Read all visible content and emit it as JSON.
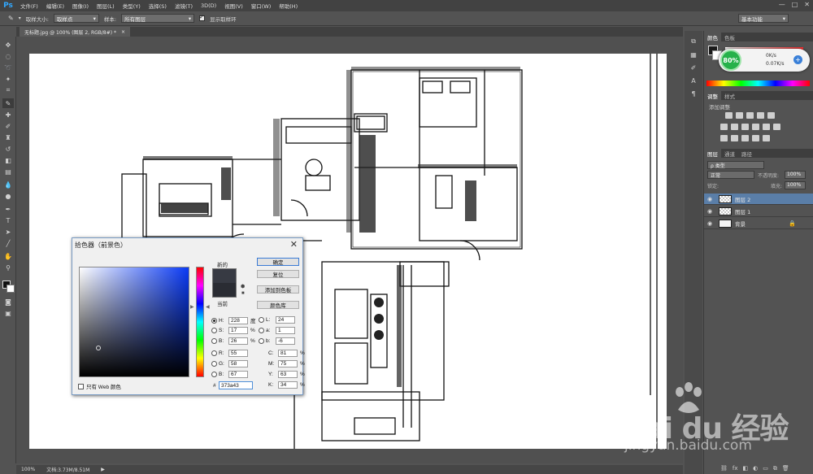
{
  "app": {
    "logo": "Ps"
  },
  "menu": [
    "文件(F)",
    "编辑(E)",
    "图像(I)",
    "图层(L)",
    "类型(Y)",
    "选择(S)",
    "滤镜(T)",
    "3D(D)",
    "视图(V)",
    "窗口(W)",
    "帮助(H)"
  ],
  "window_controls": {
    "minimize": "—",
    "maximize": "□",
    "close": "✕"
  },
  "options": {
    "sample_size_label": "取样大小:",
    "sample_size_value": "取样点",
    "sample_label": "样本:",
    "sample_value": "所有图层",
    "show_ring_label": "显示取样环",
    "workspace": "基本功能"
  },
  "document_tab": {
    "title": "无标题.jpg @ 100% (图层 2, RGB/8#) *",
    "close": "×"
  },
  "status": {
    "zoom": "100%",
    "doc": "文档:3.73M/8.51M"
  },
  "panels": {
    "color_tabs": [
      "颜色",
      "色板"
    ],
    "adjust_tabs": [
      "调整",
      "样式"
    ],
    "adjust_add_label": "添加调整",
    "layer_tabs": [
      "图层",
      "通道",
      "路径"
    ],
    "layer_filter": "ρ 类型",
    "blend_mode": "正常",
    "opacity_label": "不透明度:",
    "opacity_value": "100%",
    "lock_label": "锁定:",
    "fill_label": "填充:",
    "fill_value": "100%",
    "layers": [
      {
        "name": "图层 2",
        "selected": true,
        "bg": false
      },
      {
        "name": "图层 1",
        "selected": false,
        "bg": false
      },
      {
        "name": "背景",
        "selected": false,
        "bg": true,
        "locked": true
      }
    ]
  },
  "net_widget": {
    "percent": "80%",
    "up": "0K/s",
    "down": "0.07K/s",
    "plus": "+"
  },
  "picker": {
    "title": "拾色器（前景色）",
    "close": "✕",
    "new_label": "新的",
    "current_label": "当前",
    "new_color": "#373a43",
    "current_color": "#2a2c33",
    "buttons": {
      "ok": "确定",
      "reset": "复位",
      "add_swatch": "添加到色板",
      "libraries": "颜色库"
    },
    "hsb": [
      {
        "label": "H:",
        "value": "228",
        "unit": "度",
        "selected": true
      },
      {
        "label": "S:",
        "value": "17",
        "unit": "%",
        "selected": false
      },
      {
        "label": "B:",
        "value": "26",
        "unit": "%",
        "selected": false
      }
    ],
    "rgb": [
      {
        "label": "R:",
        "value": "55"
      },
      {
        "label": "G:",
        "value": "58"
      },
      {
        "label": "B:",
        "value": "67"
      }
    ],
    "lab": [
      {
        "label": "L:",
        "value": "24"
      },
      {
        "label": "a:",
        "value": "1"
      },
      {
        "label": "b:",
        "value": "-6"
      }
    ],
    "cmyk": [
      {
        "label": "C:",
        "value": "81",
        "unit": "%"
      },
      {
        "label": "M:",
        "value": "75",
        "unit": "%"
      },
      {
        "label": "Y:",
        "value": "63",
        "unit": "%"
      },
      {
        "label": "K:",
        "value": "34",
        "unit": "%"
      }
    ],
    "hex_label": "#",
    "hex": "373a43",
    "web_only": "只有 Web 颜色",
    "saturation": 0.17,
    "brightness": 0.26,
    "hue_fraction": 0.37
  },
  "watermark": {
    "logo": "Bai du 经验",
    "site": "jingyan.baidu.com"
  }
}
